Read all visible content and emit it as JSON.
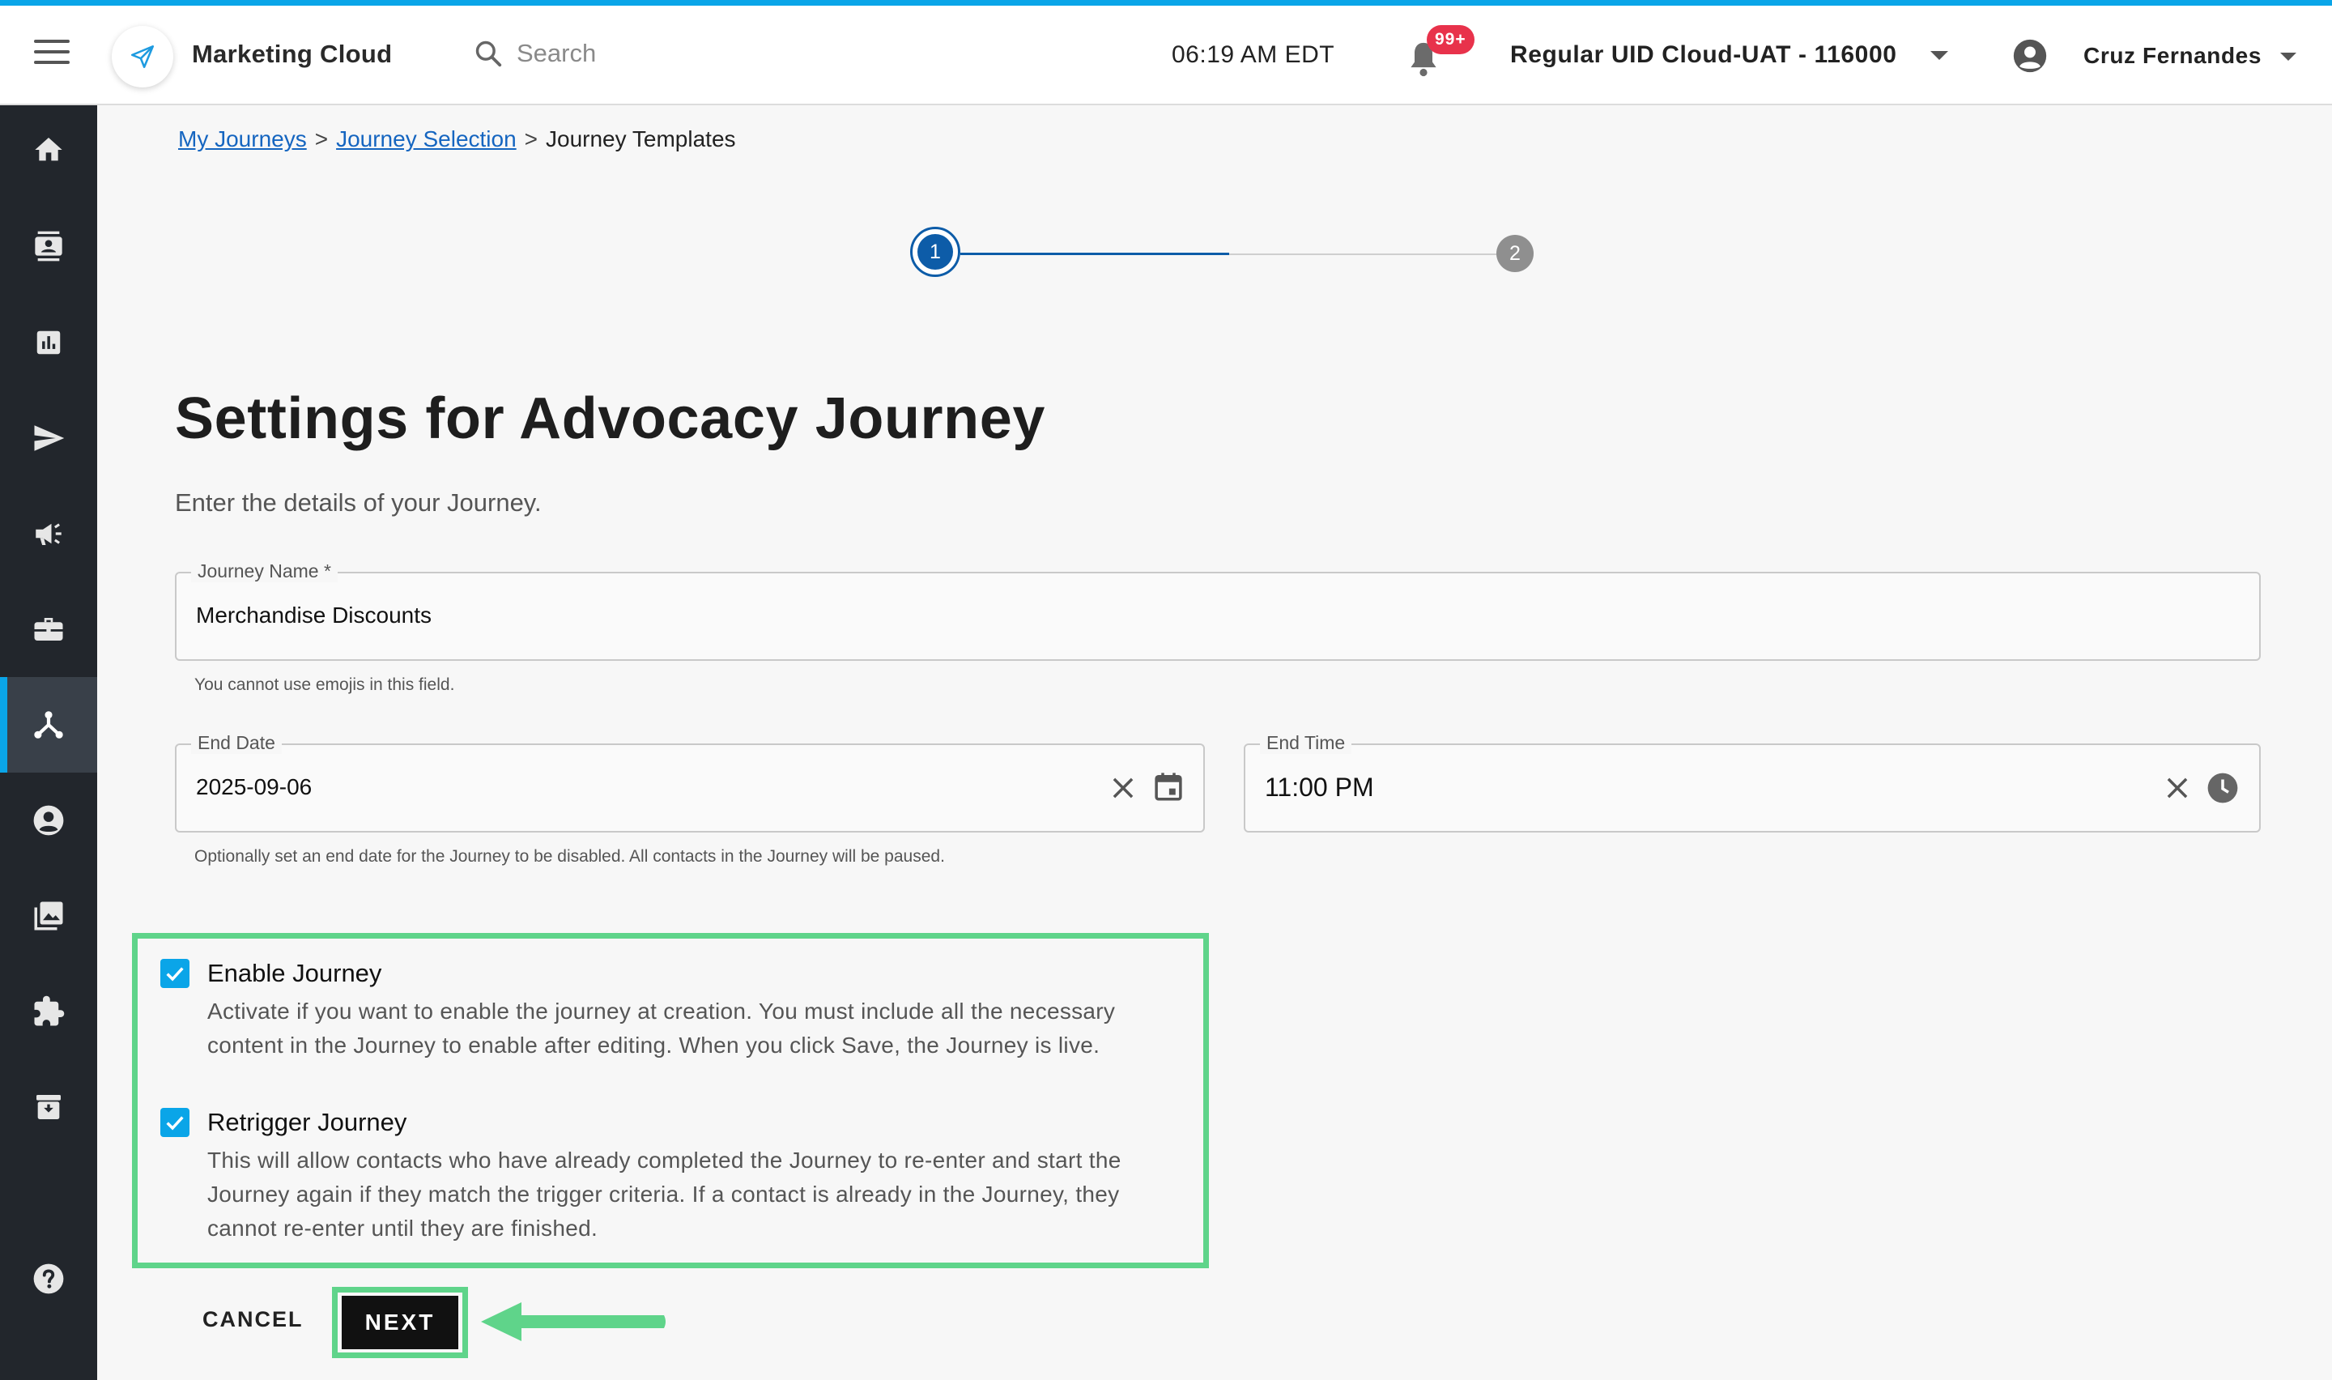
{
  "header": {
    "app_name": "Marketing Cloud",
    "search_placeholder": "Search",
    "time": "06:19 AM EDT",
    "notification_badge": "99+",
    "account": "Regular UID Cloud-UAT - 116000",
    "user_name": "Cruz Fernandes"
  },
  "sidebar": {
    "items": [
      {
        "icon": "home-icon"
      },
      {
        "icon": "contacts-icon"
      },
      {
        "icon": "analytics-icon"
      },
      {
        "icon": "send-icon"
      },
      {
        "icon": "campaign-icon"
      },
      {
        "icon": "briefcase-icon"
      },
      {
        "icon": "journeys-icon",
        "active": true
      },
      {
        "icon": "account-icon"
      },
      {
        "icon": "gallery-icon"
      },
      {
        "icon": "extensions-icon"
      },
      {
        "icon": "archive-icon"
      },
      {
        "icon": "help-icon"
      }
    ]
  },
  "breadcrumb": {
    "items": [
      "My Journeys",
      "Journey Selection",
      "Journey Templates"
    ],
    "separator": ">"
  },
  "stepper": {
    "step1": "1",
    "step2": "2"
  },
  "page": {
    "title": "Settings for Advocacy Journey",
    "subtitle": "Enter the details of your Journey."
  },
  "form": {
    "journey_name": {
      "label": "Journey Name *",
      "value": "Merchandise Discounts",
      "helper": "You cannot use emojis in this field."
    },
    "end_date": {
      "label": "End Date",
      "value": "2025-09-06",
      "helper": "Optionally set an end date for the Journey to be disabled. All contacts in the Journey will be paused."
    },
    "end_time": {
      "label": "End Time",
      "value": "11:00 PM"
    },
    "enable_journey": {
      "label": "Enable Journey",
      "checked": true,
      "description": "Activate if you want to enable the journey at creation. You must include all the necessary content in the Journey to enable after editing. When you click Save, the Journey is live."
    },
    "retrigger_journey": {
      "label": "Retrigger Journey",
      "checked": true,
      "description": "This will allow contacts who have already completed the Journey to re-enter and start the Journey again if they match the trigger criteria. If a contact is already in the Journey, they cannot re-enter until they are finished."
    }
  },
  "actions": {
    "cancel": "CANCEL",
    "next": "NEXT"
  },
  "colors": {
    "accent": "#0aa5e8",
    "stepper": "#0d5ca8",
    "highlight": "#5fd48a",
    "sidebar": "#22262c"
  }
}
